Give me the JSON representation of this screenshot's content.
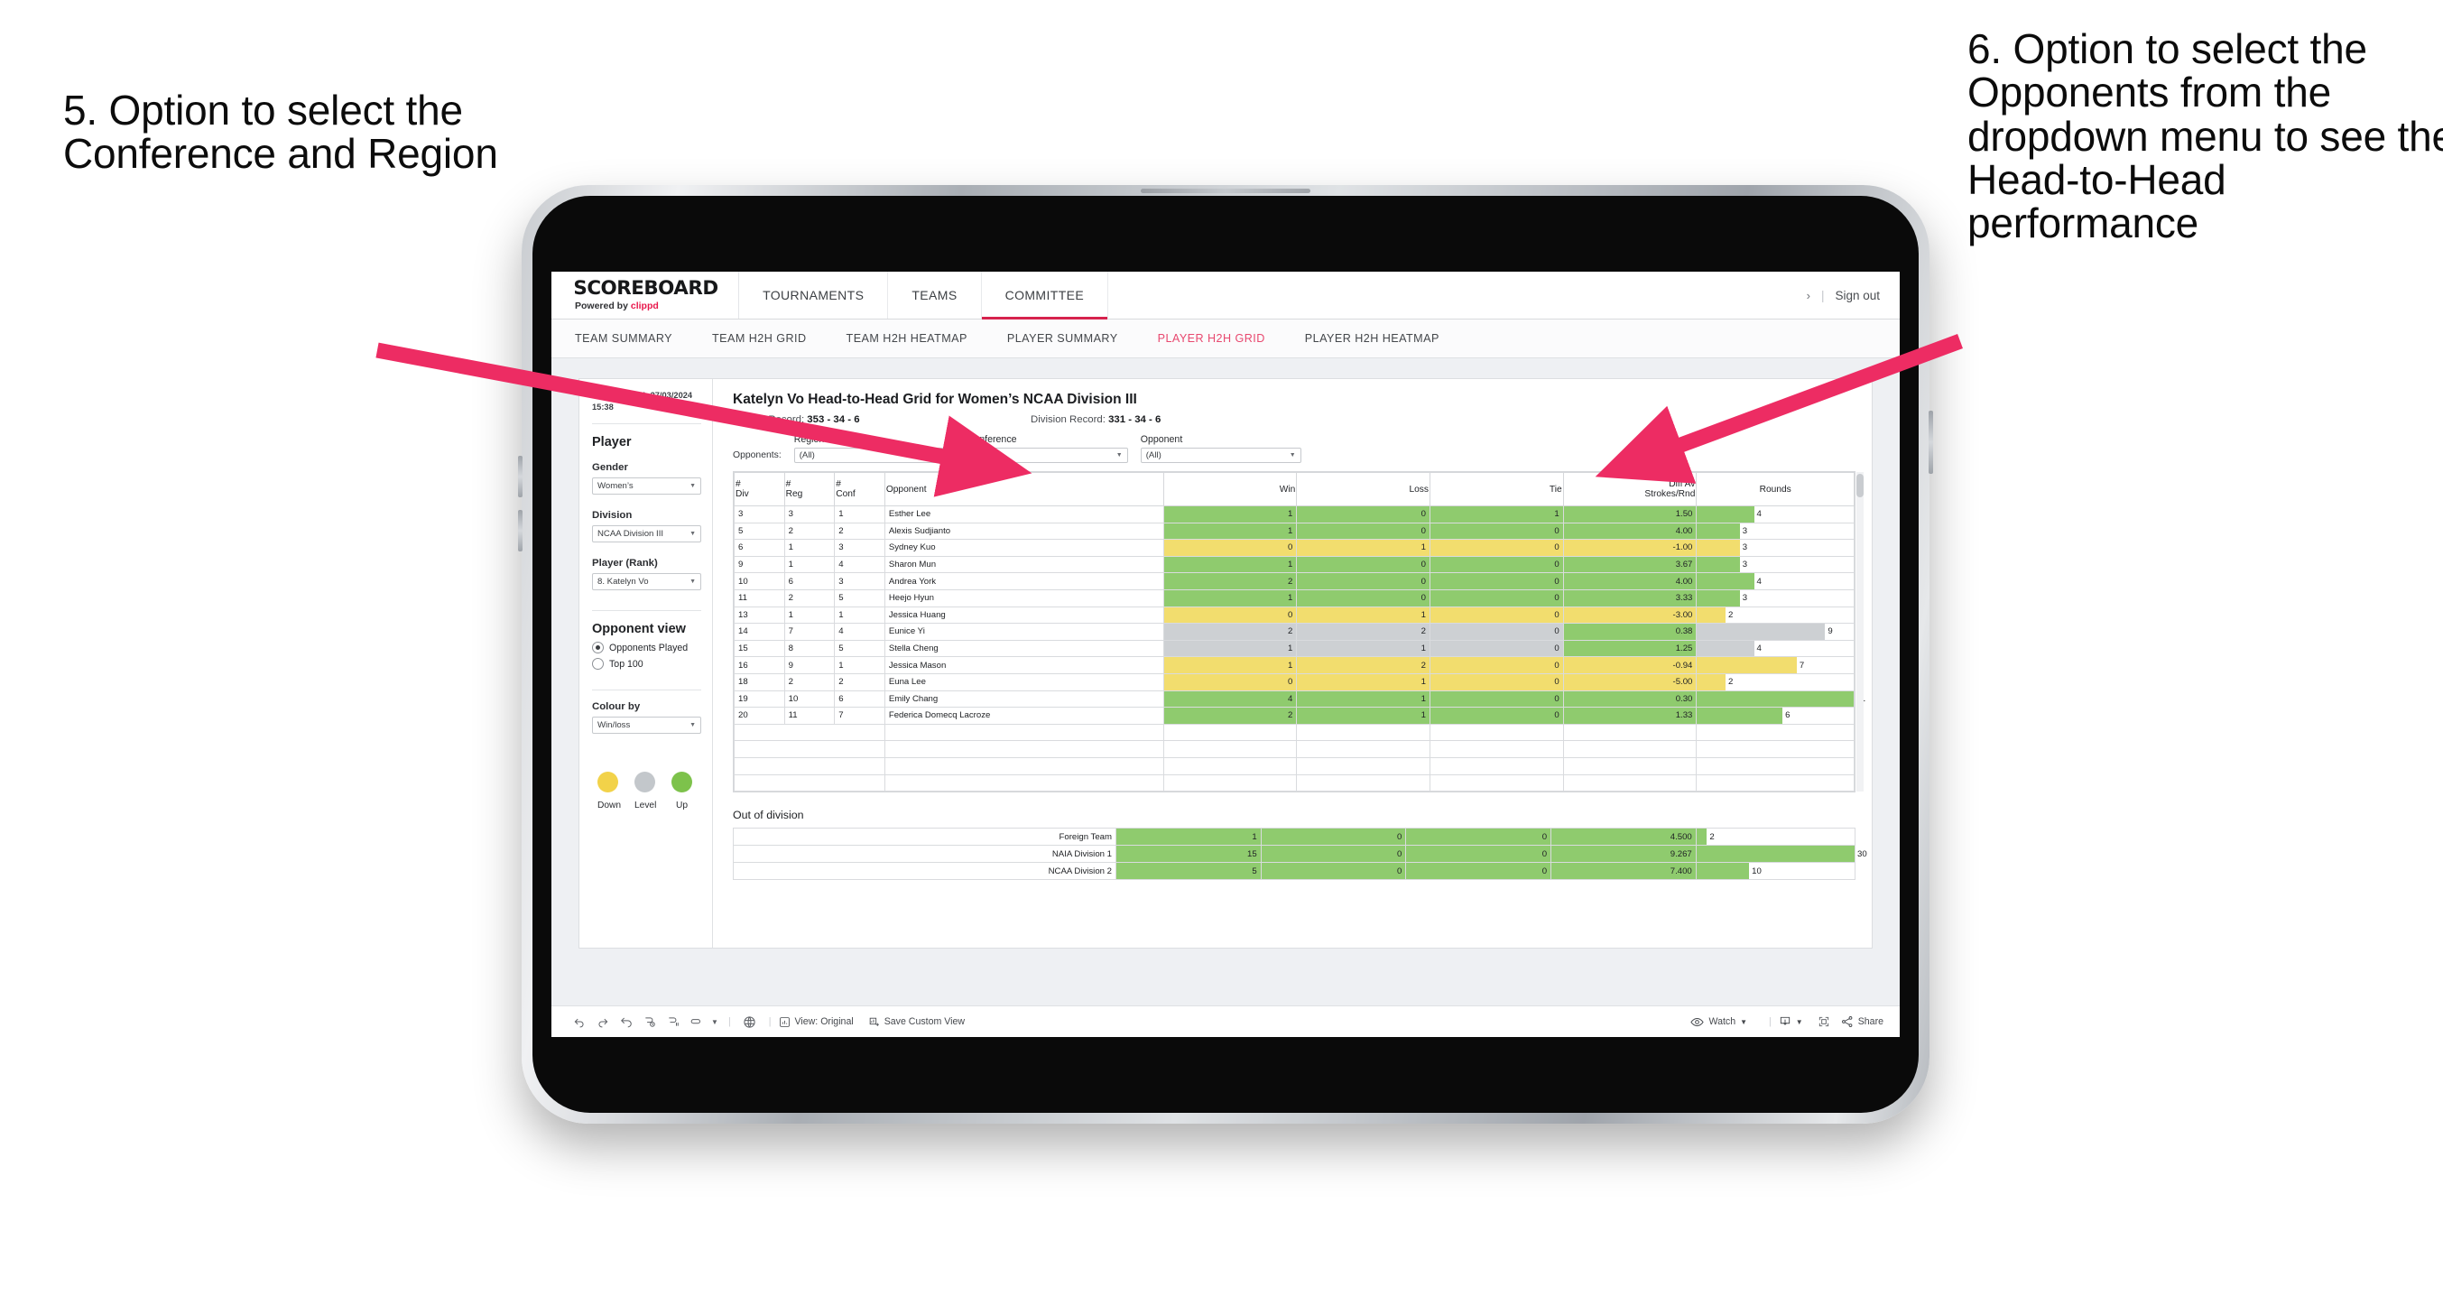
{
  "annotations": {
    "left": "5. Option to select the Conference and Region",
    "right": "6. Option to select the Opponents from the dropdown menu to see the Head-to-Head performance",
    "arrow_color": "#ED2C63"
  },
  "app": {
    "brand": {
      "title": "SCOREBOARD",
      "powered_prefix": "Powered by ",
      "powered_name": "clippd"
    },
    "top_nav": [
      {
        "label": "TOURNAMENTS",
        "active": false
      },
      {
        "label": "TEAMS",
        "active": false
      },
      {
        "label": "COMMITTEE",
        "active": true
      }
    ],
    "header_right": {
      "chevron": "›",
      "divider": "|",
      "sign_out": "Sign out"
    },
    "sub_nav": [
      {
        "label": "TEAM SUMMARY",
        "active": false
      },
      {
        "label": "TEAM H2H GRID",
        "active": false
      },
      {
        "label": "TEAM H2H HEATMAP",
        "active": false
      },
      {
        "label": "PLAYER SUMMARY",
        "active": false
      },
      {
        "label": "PLAYER H2H GRID",
        "active": true
      },
      {
        "label": "PLAYER H2H HEATMAP",
        "active": false
      }
    ]
  },
  "sidebar": {
    "last_updated": "Last Updated: 27/03/2024 15:38",
    "heading": "Player",
    "fields": [
      {
        "label": "Gender",
        "value": "Women’s"
      },
      {
        "label": "Division",
        "value": "NCAA Division III"
      },
      {
        "label": "Player (Rank)",
        "value": "8. Katelyn Vo"
      }
    ],
    "opponent_view": {
      "heading": "Opponent view",
      "options": [
        {
          "label": "Opponents Played",
          "selected": true
        },
        {
          "label": "Top 100",
          "selected": false
        }
      ]
    },
    "colour_by": {
      "label": "Colour by",
      "value": "Win/loss"
    },
    "legend": [
      {
        "label": "Down",
        "color": "#F2D249"
      },
      {
        "label": "Level",
        "color": "#C3C7CB"
      },
      {
        "label": "Up",
        "color": "#7DC24B"
      }
    ]
  },
  "main": {
    "title": "Katelyn Vo Head-to-Head Grid for Women’s NCAA Division III",
    "overall_record_label": "Overall Record: ",
    "overall_record_value": "353 -  34 - 6",
    "division_record_label": "Division Record: ",
    "division_record_value": "331 -  34 - 6",
    "filters_prefix": "Opponents:",
    "filters": [
      {
        "label": "Region",
        "value": "(All)"
      },
      {
        "label": "Conference",
        "value": "(All)"
      },
      {
        "label": "Opponent",
        "value": "(All)"
      }
    ],
    "columns": [
      "#\nDiv",
      "#\nReg",
      "#\nConf",
      "Opponent",
      "Win",
      "Loss",
      "Tie",
      "Diff Av\nStrokes/Rnd",
      "Rounds"
    ],
    "column_labels": {
      "div_top": "#",
      "div_bot": "Div",
      "reg_top": "#",
      "reg_bot": "Reg",
      "conf_top": "#",
      "conf_bot": "Conf",
      "opponent": "Opponent",
      "win": "Win",
      "loss": "Loss",
      "tie": "Tie",
      "diff_top": "Diff Av",
      "diff_bot": "Strokes/Rnd",
      "rounds": "Rounds"
    },
    "out_of_division_title": "Out of division"
  },
  "chart_data": {
    "type": "table",
    "title": "Katelyn Vo Head-to-Head Grid for Women’s NCAA Division III",
    "columns": [
      "# Div",
      "# Reg",
      "# Conf",
      "Opponent",
      "Win",
      "Loss",
      "Tie",
      "Diff Av Strokes/Rnd",
      "Rounds"
    ],
    "colors": {
      "up": "#8FCB6E",
      "down": "#F2DD6E",
      "level": "#CDD0D3",
      "rounds_max": 11
    },
    "rows": [
      {
        "div": "3",
        "reg": "3",
        "conf": "1",
        "opponent": "Esther Lee",
        "win": "1",
        "loss": "0",
        "tie": "1",
        "diff": "1.50",
        "rounds": "4",
        "state": "up"
      },
      {
        "div": "5",
        "reg": "2",
        "conf": "2",
        "opponent": "Alexis Sudjianto",
        "win": "1",
        "loss": "0",
        "tie": "0",
        "diff": "4.00",
        "rounds": "3",
        "state": "up"
      },
      {
        "div": "6",
        "reg": "1",
        "conf": "3",
        "opponent": "Sydney Kuo",
        "win": "0",
        "loss": "1",
        "tie": "0",
        "diff": "-1.00",
        "rounds": "3",
        "state": "down"
      },
      {
        "div": "9",
        "reg": "1",
        "conf": "4",
        "opponent": "Sharon Mun",
        "win": "1",
        "loss": "0",
        "tie": "0",
        "diff": "3.67",
        "rounds": "3",
        "state": "up"
      },
      {
        "div": "10",
        "reg": "6",
        "conf": "3",
        "opponent": "Andrea York",
        "win": "2",
        "loss": "0",
        "tie": "0",
        "diff": "4.00",
        "rounds": "4",
        "state": "up"
      },
      {
        "div": "11",
        "reg": "2",
        "conf": "5",
        "opponent": "Heejo Hyun",
        "win": "1",
        "loss": "0",
        "tie": "0",
        "diff": "3.33",
        "rounds": "3",
        "state": "up"
      },
      {
        "div": "13",
        "reg": "1",
        "conf": "1",
        "opponent": "Jessica Huang",
        "win": "0",
        "loss": "1",
        "tie": "0",
        "diff": "-3.00",
        "rounds": "2",
        "state": "down"
      },
      {
        "div": "14",
        "reg": "7",
        "conf": "4",
        "opponent": "Eunice Yi",
        "win": "2",
        "loss": "2",
        "tie": "0",
        "diff": "0.38",
        "rounds": "9",
        "state": "level",
        "diff_state": "up"
      },
      {
        "div": "15",
        "reg": "8",
        "conf": "5",
        "opponent": "Stella Cheng",
        "win": "1",
        "loss": "1",
        "tie": "0",
        "diff": "1.25",
        "rounds": "4",
        "state": "level",
        "diff_state": "up"
      },
      {
        "div": "16",
        "reg": "9",
        "conf": "1",
        "opponent": "Jessica Mason",
        "win": "1",
        "loss": "2",
        "tie": "0",
        "diff": "-0.94",
        "rounds": "7",
        "state": "down"
      },
      {
        "div": "18",
        "reg": "2",
        "conf": "2",
        "opponent": "Euna Lee",
        "win": "0",
        "loss": "1",
        "tie": "0",
        "diff": "-5.00",
        "rounds": "2",
        "state": "down"
      },
      {
        "div": "19",
        "reg": "10",
        "conf": "6",
        "opponent": "Emily Chang",
        "win": "4",
        "loss": "1",
        "tie": "0",
        "diff": "0.30",
        "rounds": "11",
        "state": "up"
      },
      {
        "div": "20",
        "reg": "11",
        "conf": "7",
        "opponent": "Federica Domecq Lacroze",
        "win": "2",
        "loss": "1",
        "tie": "0",
        "diff": "1.33",
        "rounds": "6",
        "state": "up"
      }
    ],
    "out_of_division": {
      "title": "Out of division",
      "rows": [
        {
          "name": "Foreign Team",
          "win": "1",
          "loss": "0",
          "tie": "0",
          "diff": "4.500",
          "rounds": "2",
          "state": "up"
        },
        {
          "name": "NAIA Division 1",
          "win": "15",
          "loss": "0",
          "tie": "0",
          "diff": "9.267",
          "rounds": "30",
          "state": "up"
        },
        {
          "name": "NCAA Division 2",
          "win": "5",
          "loss": "0",
          "tie": "0",
          "diff": "7.400",
          "rounds": "10",
          "state": "up"
        }
      ],
      "rounds_max": 30
    }
  },
  "toolbar": {
    "icons": [
      "undo-icon",
      "redo-icon",
      "revert-icon",
      "refresh-icon",
      "pause-icon",
      "highlight-icon"
    ],
    "view_label": "View: Original",
    "save_label": "Save Custom View",
    "watch_label": "Watch",
    "share_label": "Share"
  }
}
